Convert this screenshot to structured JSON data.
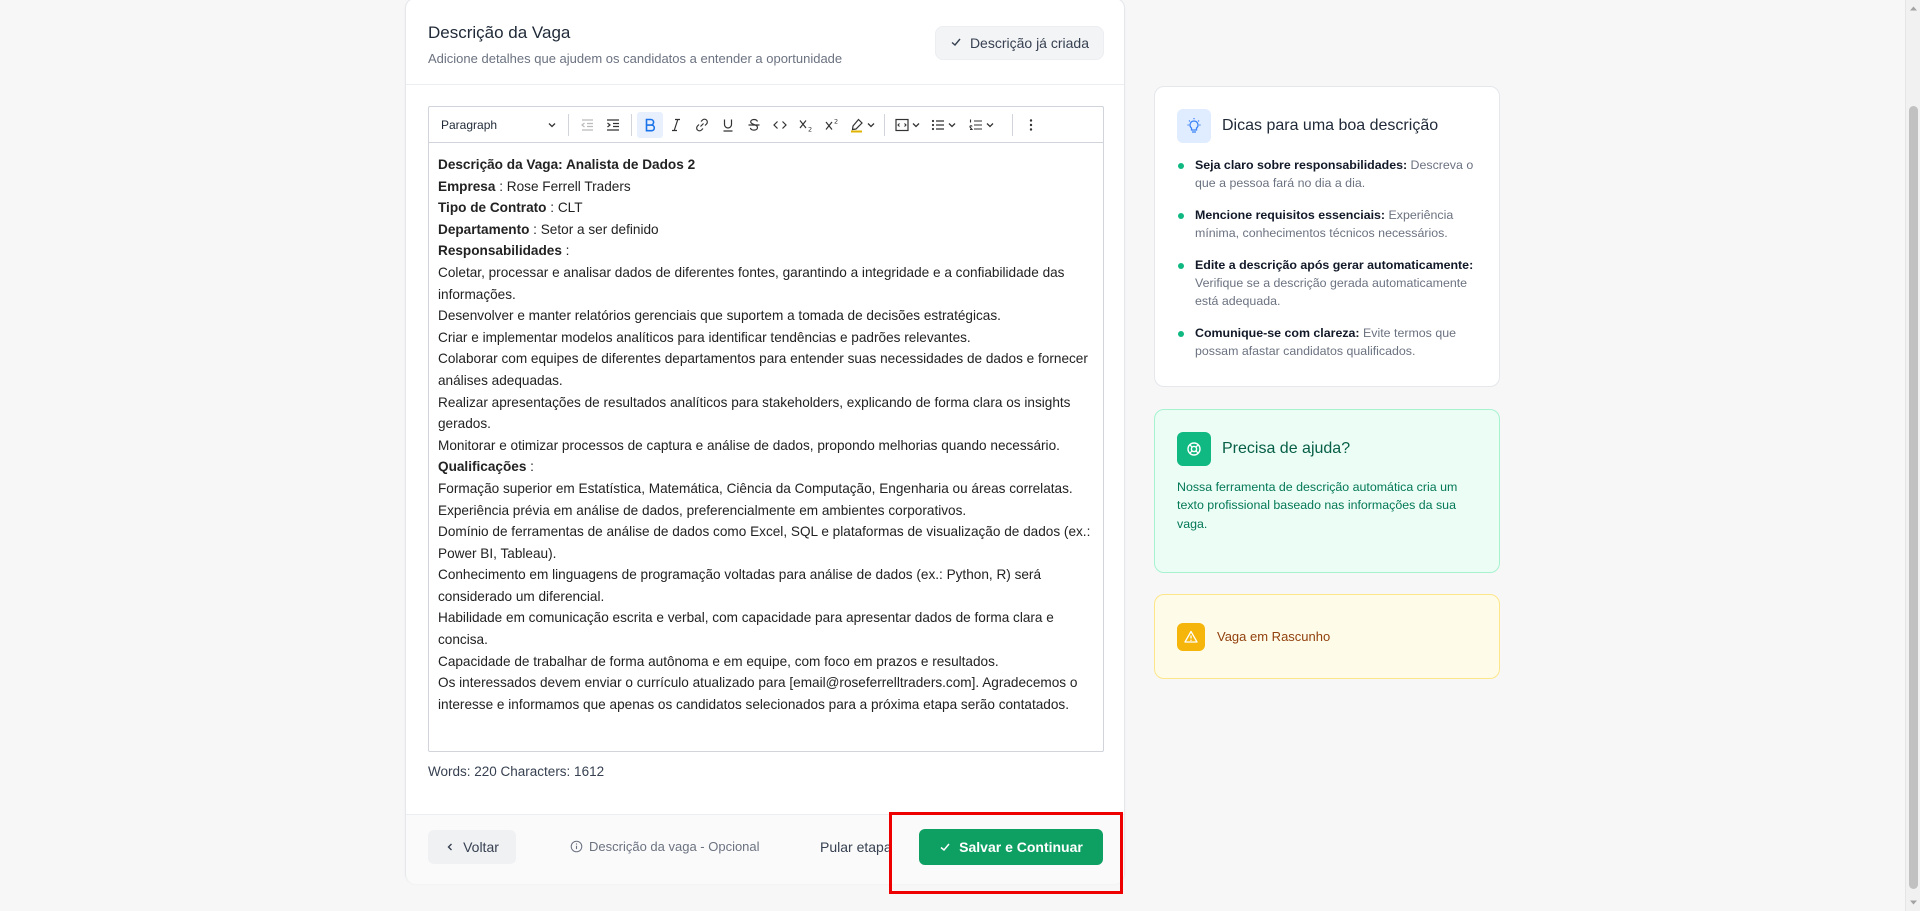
{
  "header": {
    "title": "Descrição da Vaga",
    "subtitle": "Adicione detalhes que ajudem os candidatos a entender a oportunidade",
    "created_label": "Descrição já criada"
  },
  "toolbar": {
    "paragraph_label": "Paragraph",
    "buttons": [
      "outdent-icon",
      "indent-icon",
      "bold-icon",
      "italic-icon",
      "link-icon",
      "underline-icon",
      "strikethrough-icon",
      "code-icon",
      "subscript-icon",
      "superscript-icon",
      "highlight-icon",
      "source-code-icon",
      "bullet-list-icon",
      "numbered-list-icon",
      "more-icon"
    ]
  },
  "editor": {
    "lines": [
      {
        "bold": "Descrição da Vaga: Analista de Dados 2",
        "text": ""
      },
      {
        "bold": "Empresa",
        "text": " : Rose Ferrell Traders"
      },
      {
        "bold": "Tipo de Contrato",
        "text": " : CLT"
      },
      {
        "bold": "Departamento",
        "text": " : Setor a ser definido"
      },
      {
        "bold": "Responsabilidades",
        "text": " :"
      },
      {
        "bold": "",
        "text": "Coletar, processar e analisar dados de diferentes fontes, garantindo a integridade e a confiabilidade das informações."
      },
      {
        "bold": "",
        "text": "Desenvolver e manter relatórios gerenciais que suportem a tomada de decisões estratégicas."
      },
      {
        "bold": "",
        "text": "Criar e implementar modelos analíticos para identificar tendências e padrões relevantes."
      },
      {
        "bold": "",
        "text": "Colaborar com equipes de diferentes departamentos para entender suas necessidades de dados e fornecer análises adequadas."
      },
      {
        "bold": "",
        "text": "Realizar apresentações de resultados analíticos para stakeholders, explicando de forma clara os insights gerados."
      },
      {
        "bold": "",
        "text": "Monitorar e otimizar processos de captura e análise de dados, propondo melhorias quando necessário."
      },
      {
        "bold": "Qualificações",
        "text": " :"
      },
      {
        "bold": "",
        "text": "Formação superior em Estatística, Matemática, Ciência da Computação, Engenharia ou áreas correlatas."
      },
      {
        "bold": "",
        "text": "Experiência prévia em análise de dados, preferencialmente em ambientes corporativos."
      },
      {
        "bold": "",
        "text": "Domínio de ferramentas de análise de dados como Excel, SQL e plataformas de visualização de dados (ex.: Power BI, Tableau)."
      },
      {
        "bold": "",
        "text": "Conhecimento em linguagens de programação voltadas para análise de dados (ex.: Python, R) será considerado um diferencial."
      },
      {
        "bold": "",
        "text": "Habilidade em comunicação escrita e verbal, com capacidade para apresentar dados de forma clara e concisa."
      },
      {
        "bold": "",
        "text": "Capacidade de trabalhar de forma autônoma e em equipe, com foco em prazos e resultados."
      },
      {
        "bold": "",
        "text": "Os interessados devem enviar o currículo atualizado para [email@roseferrelltraders.com]. Agradecemos o interesse e informamos que apenas os candidatos selecionados para a próxima etapa serão contatados."
      }
    ],
    "counter": "Words: 220  Characters: 1612"
  },
  "footer": {
    "back_label": "Voltar",
    "optional_label": "Descrição da vaga - Opcional",
    "skip_label": "Pular etapa",
    "save_label": "Salvar e Continuar"
  },
  "tips": {
    "title": "Dicas para uma boa descrição",
    "items": [
      {
        "bold": "Seja claro sobre responsabilidades:",
        "text": " Descreva o que a pessoa fará no dia a dia."
      },
      {
        "bold": "Mencione requisitos essenciais:",
        "text": " Experiência mínima, conhecimentos técnicos necessários."
      },
      {
        "bold": "Edite a descrição após gerar automaticamente:",
        "text": " Verifique se a descrição gerada automaticamente está adequada."
      },
      {
        "bold": "Comunique-se com clareza:",
        "text": " Evite termos que possam afastar candidatos qualificados."
      }
    ]
  },
  "help": {
    "title": "Precisa de ajuda?",
    "text": "Nossa ferramenta de descrição automática cria um texto profissional baseado nas informações da sua vaga."
  },
  "draft": {
    "label": "Vaga em Rascunho"
  },
  "colors": {
    "accent_green": "#0e9f63",
    "highlight_red": "#e00000",
    "tips_icon_bg": "#e0ecff",
    "help_icon_bg": "#10b981",
    "draft_icon_bg": "#f5b50a"
  }
}
